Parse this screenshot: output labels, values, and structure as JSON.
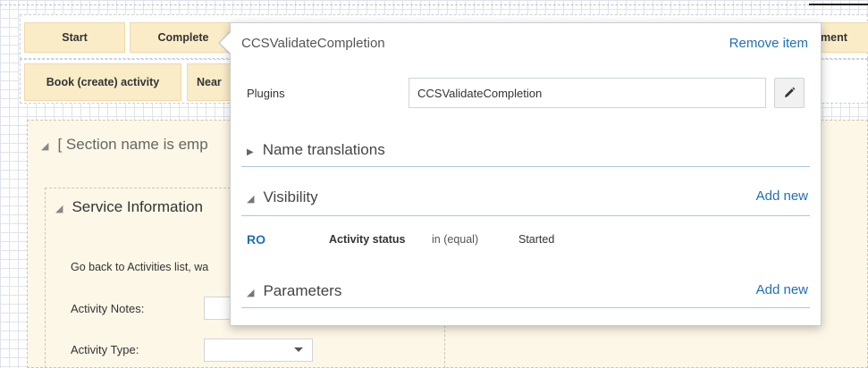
{
  "toolbar": {
    "row1": {
      "start": "Start",
      "complete": "Complete",
      "tail": "ment"
    },
    "row2": {
      "book": "Book (create) activity",
      "near": "Near"
    }
  },
  "form": {
    "section_title": "[ Section name is emp",
    "subsection_title": "Service Information",
    "go_back_text": "Go back to Activities list, wa",
    "activity_notes_label": "Activity Notes:",
    "activity_type_label": "Activity Type:"
  },
  "popover": {
    "title": "CCSValidateCompletion",
    "remove_label": "Remove item",
    "plugins_label": "Plugins",
    "plugins_value": "CCSValidateCompletion",
    "name_translations": "Name translations",
    "visibility": {
      "title": "Visibility",
      "add_new": "Add new",
      "rule": {
        "badge": "RO",
        "field": "Activity status",
        "op": "in (equal)",
        "value": "Started"
      }
    },
    "parameters": {
      "title": "Parameters",
      "add_new": "Add new"
    }
  },
  "icons": {
    "collapse": "collapse-triangle-icon",
    "expand": "expand-triangle-icon",
    "edit": "pencil-icon",
    "dropdown": "chevron-down-icon"
  },
  "colors": {
    "button_bg": "#fbecc8",
    "section_bg": "#fdf7e7",
    "link": "#1f6fb5",
    "divider": "#a9c8e3"
  }
}
